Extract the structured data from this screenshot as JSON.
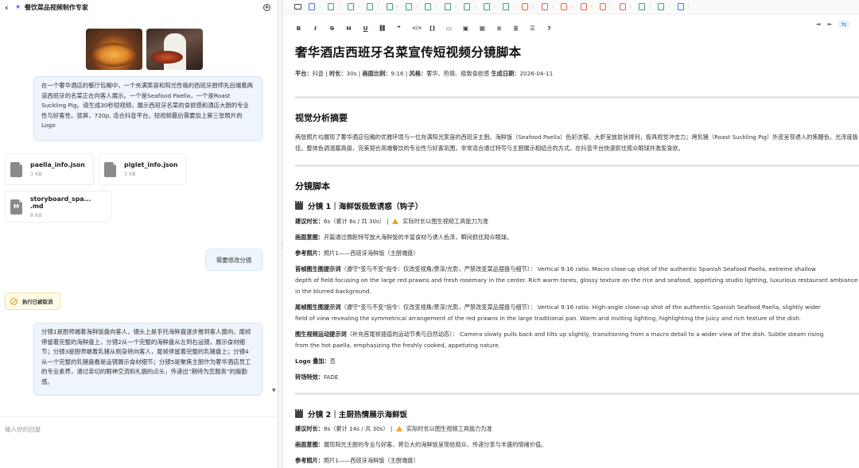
{
  "left": {
    "title": "餐饮菜品视频制作专家",
    "back_icon": "arrow-left-icon",
    "new_icon": "plus-circle-icon",
    "message1": "在一个奢华酒店的餐厅包厢中，一个充满笑容和阳光性格的西班牙厨师先后端着两道西班牙的名菜正在向客人展示。一个是Seafood Paella，一个是Roast Suckling Pig。请生成30秒短视频，展示西班牙名菜的食欲感和酒店大厨的专业性与好客性。竖屏，720p, 适合抖音平台。短视频最后需要加上第三张照片的Logo",
    "files": [
      {
        "name": "paella_info.json",
        "size": "3 KB",
        "badge": ""
      },
      {
        "name": "piglet_info.json",
        "size": "3 KB",
        "badge": ""
      },
      {
        "name": "storyboard_spa...  .md",
        "size": "8 KB",
        "badge": "M"
      }
    ],
    "request": "需要修改分镜",
    "cancelled": "执行已被取消",
    "message2": "分镜1是厨师端着海鲜饭盘向客人，镜头上是手托海鲜盘逐步推到客人面向，尾帧停留着完整的海鲜盘上，分镜2从一个完整的海鲜盘从左到右运镜，展示食材细节；分镜3是厨师端着乳猪从侧身转向客人，尾帧停留着完整的乳猪盘上；分镜4从一个完整的乳猪盘看是运镜展示食材细节；分镜5是聚焦主厨作为奢华酒店员工的专业素养，通过亲切的眼神交流和礼貌的点头，传递出“期待为您服务”的殷勤感。",
    "input_placeholder": "输入你的回复"
  },
  "toolbar": {
    "left_icons": [
      "bold-icon",
      "italic-icon",
      "strikethrough-icon",
      "heading-icon",
      "underline-icon",
      "link-icon",
      "quote-icon",
      "code-icon",
      "code-block-icon",
      "comment-icon",
      "image-icon",
      "table-icon",
      "bullet-list-icon",
      "ordered-list-icon",
      "indent-list-icon",
      "help-icon"
    ],
    "left_glyphs": [
      "B",
      "I",
      "S",
      "H",
      "U",
      "⛓",
      "❞",
      "</>",
      "[]",
      "▭",
      "▣",
      "▦",
      "≡",
      "≣",
      "☰",
      "?"
    ],
    "right_glyphs": [
      "⇥",
      "⇤",
      "⇆"
    ]
  },
  "doc": {
    "title": "奢华酒店西班牙名菜宣传短视频分镜脚本",
    "meta": [
      {
        "label": "平台：",
        "value": "抖音"
      },
      {
        "label": "时长：",
        "value": "30s"
      },
      {
        "label": "画面比例：",
        "value": "9:16"
      },
      {
        "label": "风格：",
        "value": "奢华、热情、极致食欲感"
      },
      {
        "label": "生成日期：",
        "value": "2026-04-11"
      }
    ],
    "h_visual": "视觉分析摘要",
    "visual_text": "两张照片均展现了奢华酒店包厢的优雅环境与一位充满阳光笑容的西班牙主厨。海鲜饭（Seafood Paella）色彩浓郁，大虾呈放射状排列，极具视觉冲击力；烤乳猪（Roast Suckling Pig）外皮呈现诱人的焦糖色，光泽度极佳。整体色调温暖高级，完美契合高端餐饮的专业性与好客氛围，非常适合通过特写与主厨展示相结合的方式，在抖音平台快速抓住观众眼球并激发食欲。",
    "h_storyboard": "分镜脚本",
    "shot1": {
      "title": "分镜 1｜海鲜饭极致诱惑（钩子）",
      "duration_label": "建议时长：",
      "duration": "6s（累计 6s / 共 30s）",
      "sep": "|",
      "warn_text": "实际时长以图生视频工具能力为准",
      "intent_label": "画面意图：",
      "intent": "开篇通过微距特写放大海鲜饭的丰富食材与诱人色泽，瞬间抓住观众眼球。",
      "photo_label": "参考照片：",
      "photo": "照片1——西班牙海鲜饭（主厨端盘）",
      "first_label": "首帧图生图提示词",
      "first_note": "（遵守\"变与不变\"指令：仅改变视角/景深/光影，严禁改变菜品摆盘与细节）：",
      "first_text_1": "Vertical 9:16 ratio. Macro close-up shot of the authentic Spanish Seafood Paella, extreme shallow",
      "first_text_2": "depth of field focusing on the large red prawns and fresh rosemary in the center. Rich warm tones, glossy texture on the rice and seafood, appetizing studio lighting, luxurious restaurant ambiance",
      "first_text_3": "in the blurred background.",
      "last_label": "尾帧图生图提示词",
      "last_note": "（遵守\"变与不变\"指令：仅改变视角/景深/光影，严禁改变菜品摆盘与细节）：",
      "last_text_1": "Vertical 9:16 ratio. High-angle close-up shot of the authentic Spanish Seafood Paella, slightly wider",
      "last_text_2": "field of view revealing the symmetrical arrangement of the red prawns in the large traditional pan. Warm and inviting lighting, highlighting the juicy and rich texture of the dish.",
      "motion_label": "图生视频运动提示词",
      "motion_note": "（补充首尾帧插值的运动节奏与自然动态）：",
      "motion_text_1": "Camera slowly pulls back and tilts up slightly, transitioning from a macro detail to a wider view of the dish. Subtle steam rising",
      "motion_text_2": "from the hot paella, emphasizing the freshly cooked, appetizing nature.",
      "logo_label": "Logo 叠加：",
      "logo": "否",
      "trans_label": "转场特效：",
      "trans": "FADE"
    },
    "shot2": {
      "title": "分镜 2｜主厨热情展示海鲜饭",
      "duration_label": "建议时长：",
      "duration": "8s（累计 14s / 共 30s）",
      "sep": "|",
      "warn_text": "实际时长以图生视频工具能力为准",
      "intent_label": "画面意图：",
      "intent": "展现阳光主厨的专业与好客，将巨大的海鲜饭呈现给观众，传递分享与丰盛的情绪价值。",
      "photo_label": "参考照片：",
      "photo": "照片1——西班牙海鲜饭（主厨端盘）"
    }
  },
  "colors": {
    "accent": "#3b7be0",
    "bubble": "#eef5fd",
    "warn": "#f2a51a"
  }
}
